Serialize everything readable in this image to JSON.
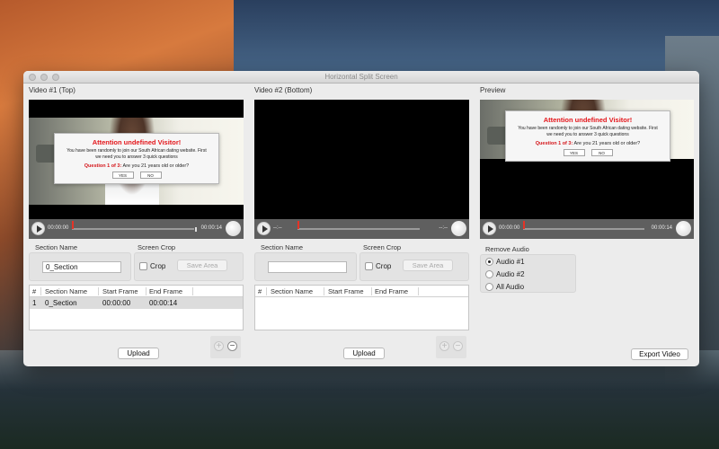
{
  "window": {
    "title": "Horizontal Split Screen"
  },
  "video1": {
    "header": "Video #1 (Top)",
    "time_start": "00:00:00",
    "time_end": "00:00:14",
    "section_name_label": "Section Name",
    "section_name_value": "0_Section",
    "screen_crop_label": "Screen Crop",
    "crop_label": "Crop",
    "save_area_label": "Save Area",
    "table": {
      "columns": [
        "#",
        "Section Name",
        "Start Frame",
        "End Frame"
      ],
      "rows": [
        [
          "1",
          "0_Section",
          "00:00:00",
          "00:00:14"
        ]
      ]
    },
    "upload_label": "Upload"
  },
  "video2": {
    "header": "Video #2 (Bottom)",
    "time_start": "--:--",
    "time_end": "--:--",
    "section_name_label": "Section Name",
    "section_name_value": "",
    "screen_crop_label": "Screen Crop",
    "crop_label": "Crop",
    "save_area_label": "Save Area",
    "table": {
      "columns": [
        "#",
        "Section Name",
        "Start Frame",
        "End Frame"
      ],
      "rows": []
    },
    "upload_label": "Upload"
  },
  "preview": {
    "header": "Preview",
    "time_start": "00:00:00",
    "time_end": "00:00:14",
    "remove_audio_label": "Remove Audio",
    "audio_options": [
      "Audio #1",
      "Audio #2",
      "All Audio"
    ],
    "selected_audio": "Audio #1",
    "export_label": "Export Video"
  },
  "popup": {
    "title": "Attention undefined Visitor!",
    "body": "You have been randomly to join our South African dating website. First we need you to answer 3 quick questions",
    "question_label": "Question 1 of 3:",
    "question_text": "Are you 21 years old or older?",
    "yes": "YES",
    "no": "NO"
  },
  "icons": {
    "play": "play-icon",
    "volume": "volume-knob-icon",
    "add": "plus-icon",
    "remove": "minus-icon"
  },
  "colors": {
    "popup_title": "#e4161b",
    "in_marker": "#e53326",
    "controls_bar": "#5f5f5f",
    "window_bg": "#ececec"
  }
}
